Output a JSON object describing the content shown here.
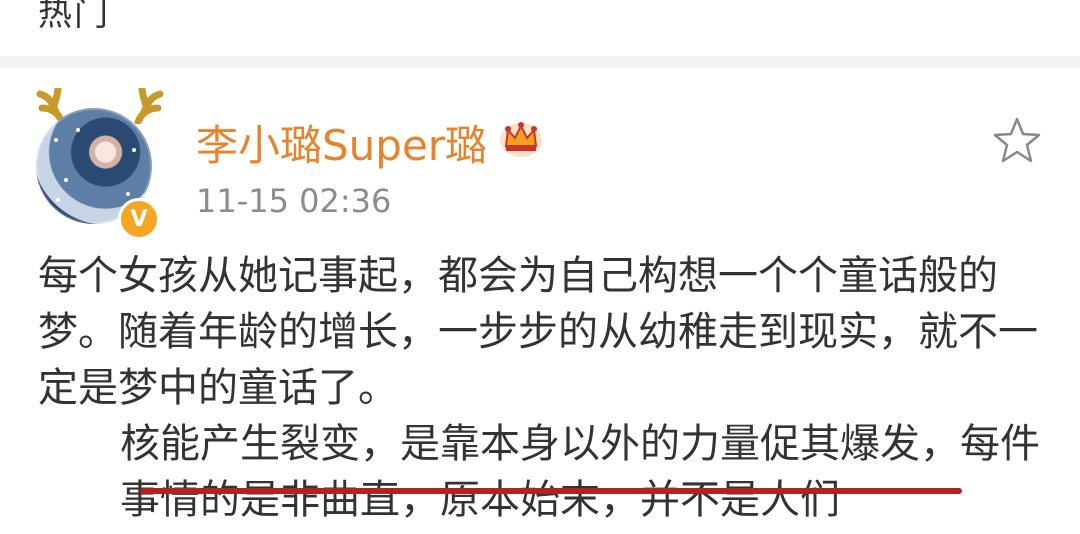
{
  "top_tab": {
    "label": "热门"
  },
  "post": {
    "username": "李小璐Super璐",
    "timestamp": "11-15 02:36",
    "verified_badge": "V",
    "paragraphs": [
      "每个女孩从她记事起，都会为自己构想一个个童话般的梦。随着年龄的增长，一步步的从幼稚走到现实，就不一定是梦中的童话了。",
      "核能产生裂变，是靠本身以外的力量促其爆发，每件事情的是非曲直，原本始末，并不是人们"
    ]
  },
  "icons": {
    "crown": "crown-icon",
    "favorite": "star-icon",
    "avatar_decoration": "antler-icon"
  },
  "colors": {
    "username": "#e8832b",
    "underline": "#b22222",
    "badge": "#f6a623"
  }
}
